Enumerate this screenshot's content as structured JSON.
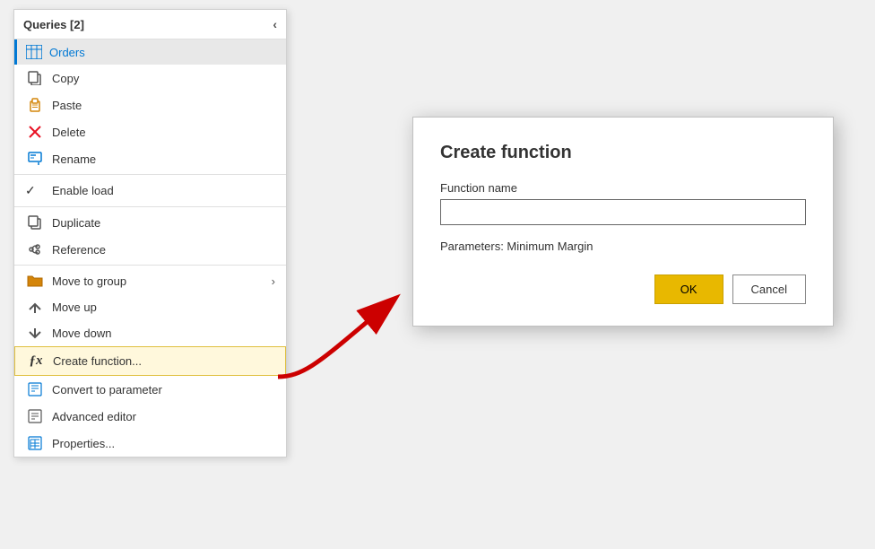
{
  "panel": {
    "title": "Queries [2]",
    "collapse_label": "‹",
    "selected_item": "Orders"
  },
  "menu": {
    "items": [
      {
        "id": "copy",
        "label": "Copy",
        "icon": "copy-icon",
        "has_submenu": false
      },
      {
        "id": "paste",
        "label": "Paste",
        "icon": "paste-icon",
        "has_submenu": false
      },
      {
        "id": "delete",
        "label": "Delete",
        "icon": "delete-icon",
        "has_submenu": false
      },
      {
        "id": "rename",
        "label": "Rename",
        "icon": "rename-icon",
        "has_submenu": false
      },
      {
        "id": "enable-load",
        "label": "Enable load",
        "icon": "check-icon",
        "has_submenu": false
      },
      {
        "id": "duplicate",
        "label": "Duplicate",
        "icon": "duplicate-icon",
        "has_submenu": false
      },
      {
        "id": "reference",
        "label": "Reference",
        "icon": "reference-icon",
        "has_submenu": false
      },
      {
        "id": "move-to-group",
        "label": "Move to group",
        "icon": "folder-icon",
        "has_submenu": true
      },
      {
        "id": "move-up",
        "label": "Move up",
        "icon": "moveup-icon",
        "has_submenu": false
      },
      {
        "id": "move-down",
        "label": "Move down",
        "icon": "movedown-icon",
        "has_submenu": false
      },
      {
        "id": "create-function",
        "label": "Create function...",
        "icon": "fx-icon",
        "has_submenu": false,
        "highlighted": true
      },
      {
        "id": "convert-to-parameter",
        "label": "Convert to parameter",
        "icon": "convert-icon",
        "has_submenu": false
      },
      {
        "id": "advanced-editor",
        "label": "Advanced editor",
        "icon": "advanced-icon",
        "has_submenu": false
      },
      {
        "id": "properties",
        "label": "Properties...",
        "icon": "properties-icon",
        "has_submenu": false
      }
    ]
  },
  "dialog": {
    "title": "Create function",
    "function_name_label": "Function name",
    "function_name_value": "",
    "function_name_placeholder": "",
    "params_label": "Parameters: Minimum Margin",
    "ok_label": "OK",
    "cancel_label": "Cancel"
  }
}
